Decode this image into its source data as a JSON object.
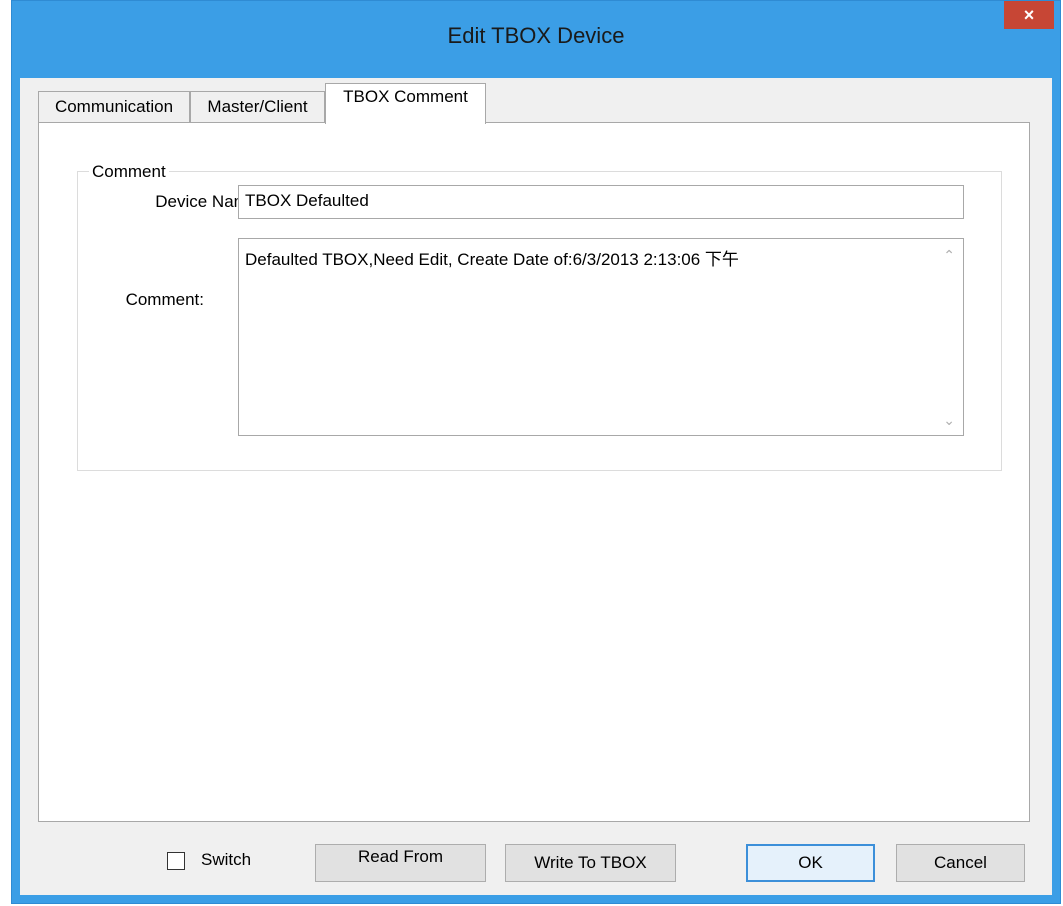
{
  "window": {
    "title": "Edit TBOX Device",
    "close_glyph": "×"
  },
  "tabs": [
    {
      "label": "Communication",
      "active": false
    },
    {
      "label": "Master/Client",
      "active": false
    },
    {
      "label": "TBOX Comment",
      "active": true
    }
  ],
  "comment_group": {
    "legend": "Comment",
    "device_name_label": "Device Name:",
    "device_name_value": "TBOX Defaulted",
    "comment_label": "Comment:",
    "comment_value": "Defaulted TBOX,Need Edit, Create Date of:6/3/2013 2:13:06 下午",
    "scroll_up_glyph": "⌃",
    "scroll_down_glyph": "⌄"
  },
  "footer": {
    "switch_label": "Switch",
    "switch_checked": false,
    "read_from_label": "Read From",
    "write_to_label": "Write To TBOX",
    "ok_label": "OK",
    "cancel_label": "Cancel"
  }
}
